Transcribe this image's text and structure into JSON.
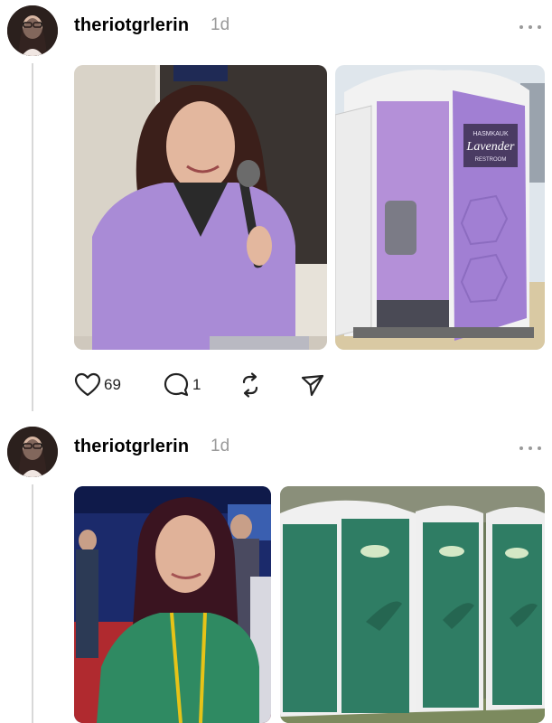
{
  "posts": [
    {
      "username": "theriotgrlerin",
      "time": "1d",
      "images": [
        {
          "description_icon": "photo-woman-purple-suit-microphone"
        },
        {
          "description_icon": "photo-purple-portable-restroom",
          "sign_line1": "HASMKAUK",
          "sign_line2": "Lavender",
          "sign_line3": "RESTROOM"
        }
      ],
      "likes": "69",
      "replies": "1"
    },
    {
      "username": "theriotgrlerin",
      "time": "1d",
      "images": [
        {
          "description_icon": "photo-woman-green-dress"
        },
        {
          "description_icon": "photo-green-portable-toilets"
        }
      ]
    }
  ],
  "colors": {
    "accent_purple": "#a98bd6",
    "toilet_green": "#2f7d64",
    "muted": "#9a9a9a"
  }
}
